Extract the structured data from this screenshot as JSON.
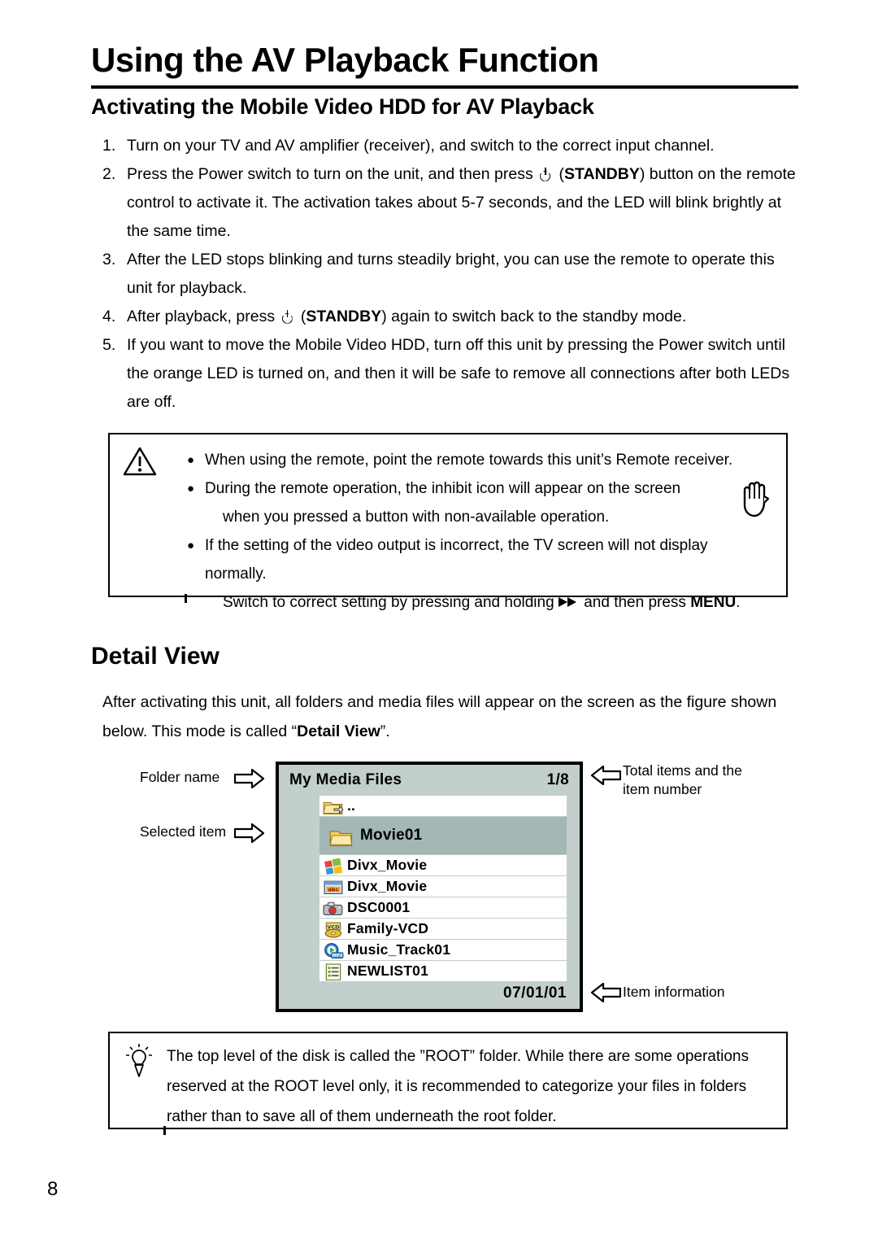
{
  "document": {
    "chapter_title": "Using the AV Playback Function",
    "section_title": "Activating the Mobile Video HDD for AV Playback",
    "page_number": "8"
  },
  "steps": [
    {
      "num": "1.",
      "parts": [
        {
          "t": "Turn on your TV and AV amplifier (receiver), and switch to the correct input channel."
        }
      ]
    },
    {
      "num": "2.",
      "parts": [
        {
          "t": "Press the Power switch to turn on the unit, and then press "
        },
        {
          "icon": "power-standby-icon"
        },
        {
          "t": " ("
        },
        {
          "t": "STANDBY",
          "b": true
        },
        {
          "t": ") button on the remote control to activate it. The activation takes about 5-7 seconds, and the LED will blink brightly at the same time."
        }
      ]
    },
    {
      "num": "3.",
      "parts": [
        {
          "t": "After the LED stops blinking and turns steadily bright, you can use the remote to operate this unit for playback."
        }
      ]
    },
    {
      "num": "4.",
      "parts": [
        {
          "t": "After playback, press "
        },
        {
          "icon": "power-standby-icon"
        },
        {
          "t": " ("
        },
        {
          "t": "STANDBY",
          "b": true
        },
        {
          "t": ") again to switch back to the standby mode."
        }
      ]
    },
    {
      "num": "5.",
      "parts": [
        {
          "t": "If you want to move the Mobile Video HDD, turn off this unit by pressing the Power switch until the orange LED is turned on, and then it will be safe to remove all connections after both LEDs are off."
        }
      ]
    }
  ],
  "caution": {
    "bullet_char": "●",
    "items": [
      {
        "lines": [
          {
            "parts": [
              {
                "t": "When using the remote, point the remote towards this unit’s Remote receiver."
              }
            ]
          }
        ]
      },
      {
        "lines": [
          {
            "parts": [
              {
                "t": "During the remote operation, the inhibit icon will appear on the screen"
              }
            ]
          },
          {
            "indent": true,
            "parts": [
              {
                "t": "when you pressed a button with non-available operation."
              }
            ]
          }
        ]
      },
      {
        "lines": [
          {
            "parts": [
              {
                "t": "If the setting of the video output is incorrect, the TV screen will not display normally."
              }
            ]
          },
          {
            "indent": true,
            "parts": [
              {
                "t": "Switch to correct setting by pressing and holding  "
              },
              {
                "icon": "fast-forward-icon"
              },
              {
                "t": " and then press "
              },
              {
                "t": "MENU",
                "b": true
              },
              {
                "t": "."
              }
            ]
          }
        ]
      }
    ]
  },
  "detail_view": {
    "heading": "Detail View",
    "intro_parts": [
      {
        "t": "After activating this unit, all folders and media files will appear on the screen as the figure shown below. This mode is called “"
      },
      {
        "t": "Detail View",
        "b": true
      },
      {
        "t": "”."
      }
    ]
  },
  "mockup": {
    "folder_name": "My Media Files",
    "item_counter": "1/8",
    "date": "07/01/01",
    "files": [
      {
        "name": "..",
        "icon": "parent-folder-icon",
        "selected": false
      },
      {
        "name": "Movie01",
        "icon": "folder-icon",
        "selected": true
      },
      {
        "name": "Divx_Movie",
        "icon": "windows-video-icon",
        "selected": false
      },
      {
        "name": "Divx_Movie",
        "icon": "subtitle-abc-icon",
        "selected": false
      },
      {
        "name": "DSC0001",
        "icon": "camera-photo-icon",
        "selected": false
      },
      {
        "name": "Family-VCD",
        "icon": "vcd-disc-icon",
        "selected": false
      },
      {
        "name": "Music_Track01",
        "icon": "mp3-music-icon",
        "selected": false
      },
      {
        "name": "NEWLIST01",
        "icon": "playlist-icon",
        "selected": false
      }
    ],
    "callouts": {
      "folder_name": "Folder name",
      "selected_item": "Selected item",
      "total_items_line1": "Total items and the",
      "total_items_line2": "item number",
      "item_information": "Item information"
    },
    "colors": {
      "screen_background": "#c2cfcd",
      "selected_row": "#a3b7b5",
      "row_background": "#ffffff",
      "border": "#000000"
    }
  },
  "tip": {
    "icon": "lightbulb-icon",
    "text": "The top level of the disk is called the ”ROOT” folder. While there are some operations reserved at the ROOT level only, it is recommended to categorize your files in folders rather than to save all of them underneath the root folder."
  }
}
